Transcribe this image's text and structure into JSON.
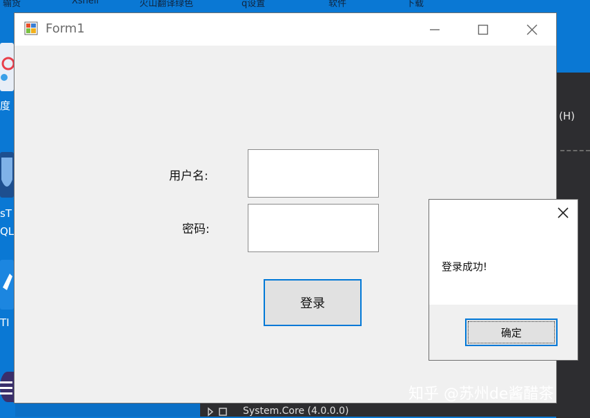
{
  "desktop": {
    "top_strip_items": [
      "输货",
      "Xshell",
      "火山翻译绿色",
      "q设置",
      "软件",
      "下载"
    ],
    "left_labels": [
      "度",
      "sT",
      "QL",
      "TI"
    ],
    "right_menu_fragment": "(H)",
    "bottom_tree_item": "System.Core (4.0.0.0)"
  },
  "form": {
    "title": "Form1",
    "username_label": "用户名:",
    "password_label": "密码:",
    "login_button": "登录",
    "username_value": "",
    "password_value": ""
  },
  "message_box": {
    "text": "登录成功!",
    "ok_button": "确定"
  },
  "watermark": "知乎 @苏州de酱醋茶",
  "colors": {
    "desktop_blue": "#0a78d4",
    "accent": "#0078d7",
    "form_bg": "#f0f0f0",
    "dark_panel": "#2d2d30"
  }
}
